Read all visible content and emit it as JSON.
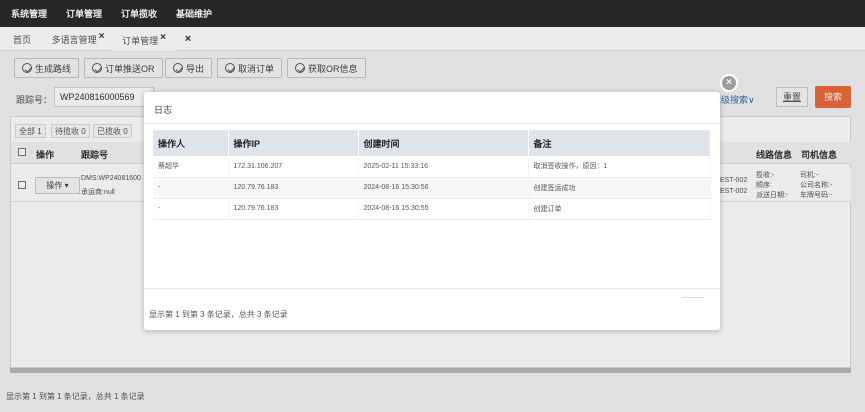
{
  "topnav": {
    "items": [
      "系统管理",
      "订单管理",
      "订单揽收",
      "基础维护"
    ]
  },
  "tabs": {
    "home": "首页",
    "multilang": "多语言管理",
    "order": "订单管理",
    "close_mark": "×"
  },
  "toolbar": {
    "generate_route": "生成路线",
    "push_or": "订单推送OR",
    "export": "导出",
    "cancel_order": "取消订单",
    "get_or_info": "获取OR信息"
  },
  "search": {
    "tracking_label": "跟踪号：",
    "tracking_value": "WP240816000569",
    "advanced_search": "高级搜索∨",
    "reset": "重置",
    "submit": "搜索"
  },
  "status_tabs": [
    "全部 1",
    "待揽收 0",
    "已揽收 0"
  ],
  "bg_table": {
    "headers": {
      "operation": "操作",
      "tracking": "跟踪号",
      "route_info": "线路信息",
      "driver_info": "司机信息"
    },
    "row": {
      "op_button": "操作 ▾",
      "tracking_line1": "DMS:WP24081600",
      "tracking_line2": "承运商:null",
      "code1": "EST-002",
      "code2": "EST-002",
      "route_lines": [
        "揽收:-",
        "顺序:",
        "派送日期:-"
      ],
      "driver_lines": [
        "司机:-",
        "公司名称:-",
        "车牌号码:-"
      ]
    }
  },
  "footer": {
    "summary": "显示第 1 到第 1 条记录，总共 1 条记录"
  },
  "modal": {
    "title": "日志",
    "close": "×",
    "columns": [
      "操作人",
      "操作IP",
      "创建时间",
      "备注"
    ],
    "rows": [
      [
        "蔡超华",
        "172.31.106.207",
        "2025-02-11 15:33:16",
        "取消签收操作，原因：1"
      ],
      [
        "-",
        "120.79.76.183",
        "2024-08-16 15:30:56",
        "创建签运成功"
      ],
      [
        "-",
        "120.79.76.183",
        "2024-08-16 15:30:55",
        "创建订单"
      ]
    ],
    "footer": "显示第 1 到第 3 条记录，总共 3 条记录"
  }
}
